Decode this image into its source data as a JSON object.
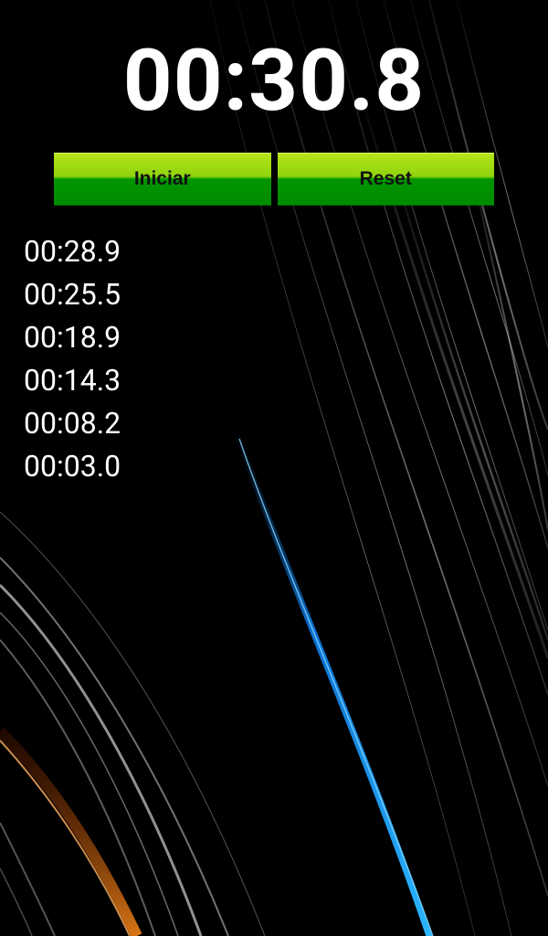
{
  "timer": {
    "display": "00:30.8"
  },
  "buttons": {
    "start_label": "Iniciar",
    "reset_label": "Reset"
  },
  "laps": [
    "00:28.9",
    "00:25.5",
    "00:18.9",
    "00:14.3",
    "00:08.2",
    "00:03.0"
  ],
  "colors": {
    "background": "#000000",
    "button_green_top": "#9ad90f",
    "button_green_bottom": "#009000",
    "accent_blue": "#1aa0ff",
    "accent_orange": "#ff6a00"
  }
}
